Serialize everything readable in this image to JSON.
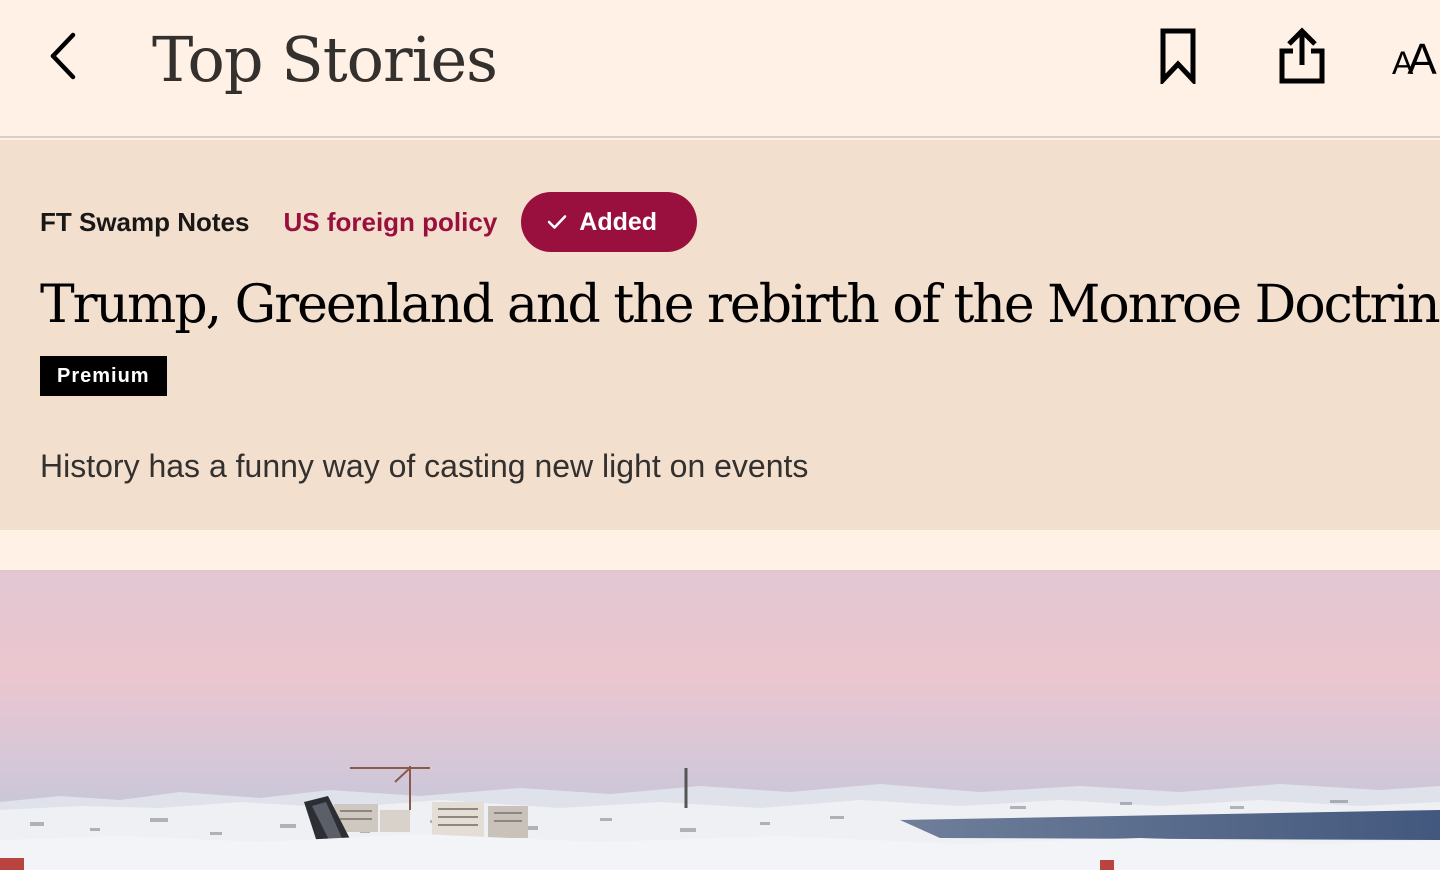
{
  "header": {
    "title": "Top Stories",
    "back_icon": "chevron-left-icon",
    "bookmark_icon": "bookmark-icon",
    "share_icon": "share-icon",
    "text_size_icon": "text-size-icon",
    "text_size_glyph_small": "A",
    "text_size_glyph_large": "A"
  },
  "article": {
    "series": "FT Swamp Notes",
    "topic": "US foreign policy",
    "follow_button": {
      "label": "Added",
      "icon": "checkmark-icon"
    },
    "headline": "Trump, Greenland and the rebirth of the Monroe Doctrine",
    "badge": "Premium",
    "standfirst": "History has a funny way of casting new light on events"
  },
  "colors": {
    "page_background": "#fff1e5",
    "hero_background": "#f2dfce",
    "accent": "#990f3d",
    "text": "#33302e"
  }
}
